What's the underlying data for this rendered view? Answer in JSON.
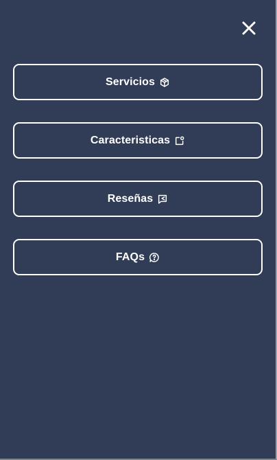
{
  "menu": {
    "close_icon": "close-icon",
    "items": [
      {
        "label": "Servicios",
        "icon": "cube-icon"
      },
      {
        "label": "Caracteristicas",
        "icon": "new-section-icon"
      },
      {
        "label": "Reseñas",
        "icon": "message-share-icon"
      },
      {
        "label": "FAQs",
        "icon": "question-circle-icon"
      }
    ]
  },
  "colors": {
    "panel_background": "#313d56",
    "foreground": "#ffffff"
  }
}
